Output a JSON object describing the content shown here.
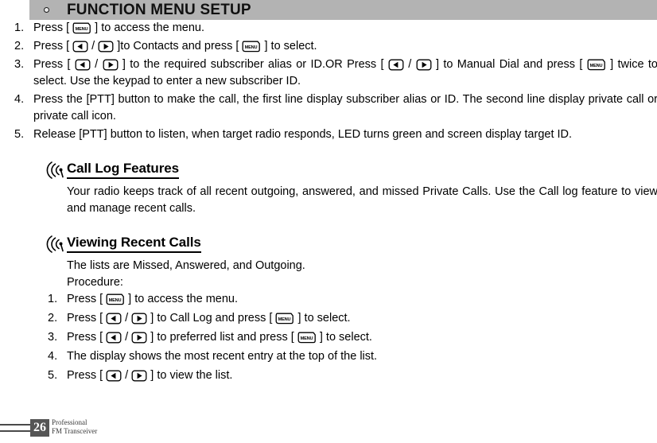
{
  "header": {
    "bullet_icon": "circle-bullet-icon",
    "title": "FUNCTION MENU SETUP"
  },
  "icons": {
    "menu_key": "menu-key-icon",
    "menu_key_label": "MENU",
    "left_key": "left-arrow-key-icon",
    "right_key": "right-arrow-key-icon",
    "antenna": "antenna-signal-icon"
  },
  "top_steps": [
    {
      "num": "1.",
      "parts": [
        {
          "t": "text",
          "v": "Press [ "
        },
        {
          "t": "key",
          "v": "menu"
        },
        {
          "t": "text",
          "v": " ] to access the menu."
        }
      ]
    },
    {
      "num": "2.",
      "parts": [
        {
          "t": "text",
          "v": "Press [ "
        },
        {
          "t": "key",
          "v": "left"
        },
        {
          "t": "text",
          "v": " / "
        },
        {
          "t": "key",
          "v": "right"
        },
        {
          "t": "text",
          "v": " ]to Contacts and press [ "
        },
        {
          "t": "key",
          "v": "menu"
        },
        {
          "t": "text",
          "v": " ] to select."
        }
      ]
    },
    {
      "num": "3.",
      "parts": [
        {
          "t": "text",
          "v": "Press [ "
        },
        {
          "t": "key",
          "v": "left"
        },
        {
          "t": "text",
          "v": " / "
        },
        {
          "t": "key",
          "v": "right"
        },
        {
          "t": "text",
          "v": " ] to the required subscriber alias or ID.OR Press [ "
        },
        {
          "t": "key",
          "v": "left"
        },
        {
          "t": "text",
          "v": " / "
        },
        {
          "t": "key",
          "v": "right"
        },
        {
          "t": "text",
          "v": " ] to Manual Dial and press [ "
        },
        {
          "t": "key",
          "v": "menu"
        },
        {
          "t": "text",
          "v": " ] twice to select. Use the keypad to enter a new subscriber ID."
        }
      ]
    },
    {
      "num": "4.",
      "parts": [
        {
          "t": "text",
          "v": "Press the [PTT] button to make the call, the first line display subscriber alias or ID. The second line display private call or private call icon."
        }
      ]
    },
    {
      "num": "5.",
      "parts": [
        {
          "t": "text",
          "v": "Release [PTT] button to listen, when target radio responds, LED turns green and screen display target ID."
        }
      ]
    }
  ],
  "sections": [
    {
      "title": "Call Log Features",
      "body": "Your radio keeps track of all recent outgoing, answered, and missed Private Calls. Use the Call log feature to view and manage recent calls."
    },
    {
      "title": "Viewing Recent Calls",
      "intro_line": "The lists are Missed, Answered, and Outgoing.",
      "procedure_label": "Procedure:",
      "steps": [
        {
          "num": "1.",
          "parts": [
            {
              "t": "text",
              "v": "Press [ "
            },
            {
              "t": "key",
              "v": "menu"
            },
            {
              "t": "text",
              "v": " ] to access the menu."
            }
          ]
        },
        {
          "num": "2.",
          "parts": [
            {
              "t": "text",
              "v": "Press  [ "
            },
            {
              "t": "key",
              "v": "left"
            },
            {
              "t": "text",
              "v": " / "
            },
            {
              "t": "key",
              "v": "right"
            },
            {
              "t": "text",
              "v": " ]  to Call Log and press [ "
            },
            {
              "t": "key",
              "v": "menu"
            },
            {
              "t": "text",
              "v": " ]  to select."
            }
          ]
        },
        {
          "num": "3.",
          "parts": [
            {
              "t": "text",
              "v": "Press  [ "
            },
            {
              "t": "key",
              "v": "left"
            },
            {
              "t": "text",
              "v": " / "
            },
            {
              "t": "key",
              "v": "right"
            },
            {
              "t": "text",
              "v": " ]  to preferred list and press [ "
            },
            {
              "t": "key",
              "v": "menu"
            },
            {
              "t": "text",
              "v": " ] to select."
            }
          ]
        },
        {
          "num": "4.",
          "parts": [
            {
              "t": "text",
              "v": "The display shows the most recent entry at the top of the list."
            }
          ]
        },
        {
          "num": "5.",
          "parts": [
            {
              "t": "text",
              "v": "Press [ "
            },
            {
              "t": "key",
              "v": "left"
            },
            {
              "t": "text",
              "v": " / "
            },
            {
              "t": "key",
              "v": "right"
            },
            {
              "t": "text",
              "v": " ] to view the list."
            }
          ]
        }
      ]
    }
  ],
  "footer": {
    "page_number": "26",
    "line1": "Professional",
    "line2": "FM Transceiver"
  },
  "colors": {
    "header_bar": "#b3b3b3",
    "page_box": "#555555",
    "text": "#000000"
  }
}
